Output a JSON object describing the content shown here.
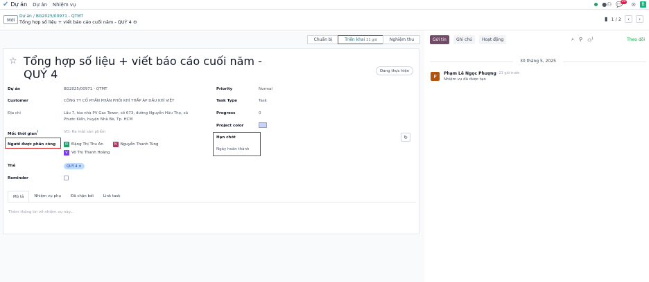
{
  "topbar": {
    "app_name": "Dự án",
    "menu": [
      "Dự án",
      "Nhiệm vụ"
    ],
    "message_count": "29",
    "user_initial": "B"
  },
  "breadcrumb": {
    "new_label": "Mới",
    "crumb_root": "Dự án",
    "crumb_project": "BG2025/00971 - QTMT",
    "record_title": "Tổng hợp số liệu + viết báo cáo cuối năm - QUÝ 4",
    "pager": "1 / 2"
  },
  "stages": [
    {
      "label": "Chuẩn bị",
      "sub": ""
    },
    {
      "label": "Triển khai",
      "sub": "21 giờ"
    },
    {
      "label": "Nghiệm thu",
      "sub": ""
    }
  ],
  "chatter": {
    "send_label": "Gửi tin",
    "note_label": "Ghi chú",
    "activity_label": "Hoạt động",
    "attachment_count": "1",
    "follow_label": "Theo dõi",
    "date": "30 tháng 5, 2025",
    "message": {
      "author_initial": "P",
      "author": "Phạm Lê Ngọc Phượng",
      "time": "- 21 giờ trước",
      "text": "Nhiệm vụ đã được tạo"
    }
  },
  "form": {
    "title": "Tổng hợp số liệu + viết báo cáo cuối năm - QUÝ 4",
    "state_label": "Đang thực hiện",
    "fields": {
      "project_label": "Dự án",
      "project_value": "BG2025/00971 - QTMT",
      "customer_label": "Customer",
      "customer_value": "CÔNG TY CỔ PHẦN PHÂN PHỐI KHÍ THẤP ÁP DẦU KHÍ VIỆT",
      "address_label": "Địa chỉ",
      "address_line1": "Lầu 7, tòa nhà PV Gas Tower, số 673, đường Nguyễn Hữu Thọ, xã",
      "address_line2": "Phước Kiển, huyện Nhà Bè, Tp. HCM",
      "milestone_label": "Mốc thời gian",
      "milestone_sup": "?",
      "milestone_value": "VD: Ra mắt sản phẩm",
      "assignees_label": "Người được phân công",
      "assignees": [
        {
          "initial": "Đ",
          "name": "Đặng Thị Thu An",
          "color": "#22a06b"
        },
        {
          "initial": "N",
          "name": "Nguyễn Thanh Tùng",
          "color": "#a23b5c"
        },
        {
          "initial": "V",
          "name": "Võ Thị Thanh Hoàng",
          "color": "#7c3aed"
        }
      ],
      "tags_label": "Thẻ",
      "tag_value": "QUÝ 4",
      "reminder_label": "Reminder",
      "priority_label": "Priority",
      "priority_value": "Normal",
      "task_type_label": "Task Type",
      "task_type_value": "Task",
      "progress_label": "Progress",
      "progress_value": "0",
      "project_color_label": "Project color",
      "deadline_label": "Hạn chót",
      "done_date_label": "Ngày hoàn thành"
    },
    "tabs": [
      "Mô tả",
      "Nhiệm vụ phụ",
      "Đã chặn bởi",
      "Link task"
    ],
    "description_placeholder": "Thêm thông tin về nhiệm vụ này..."
  }
}
